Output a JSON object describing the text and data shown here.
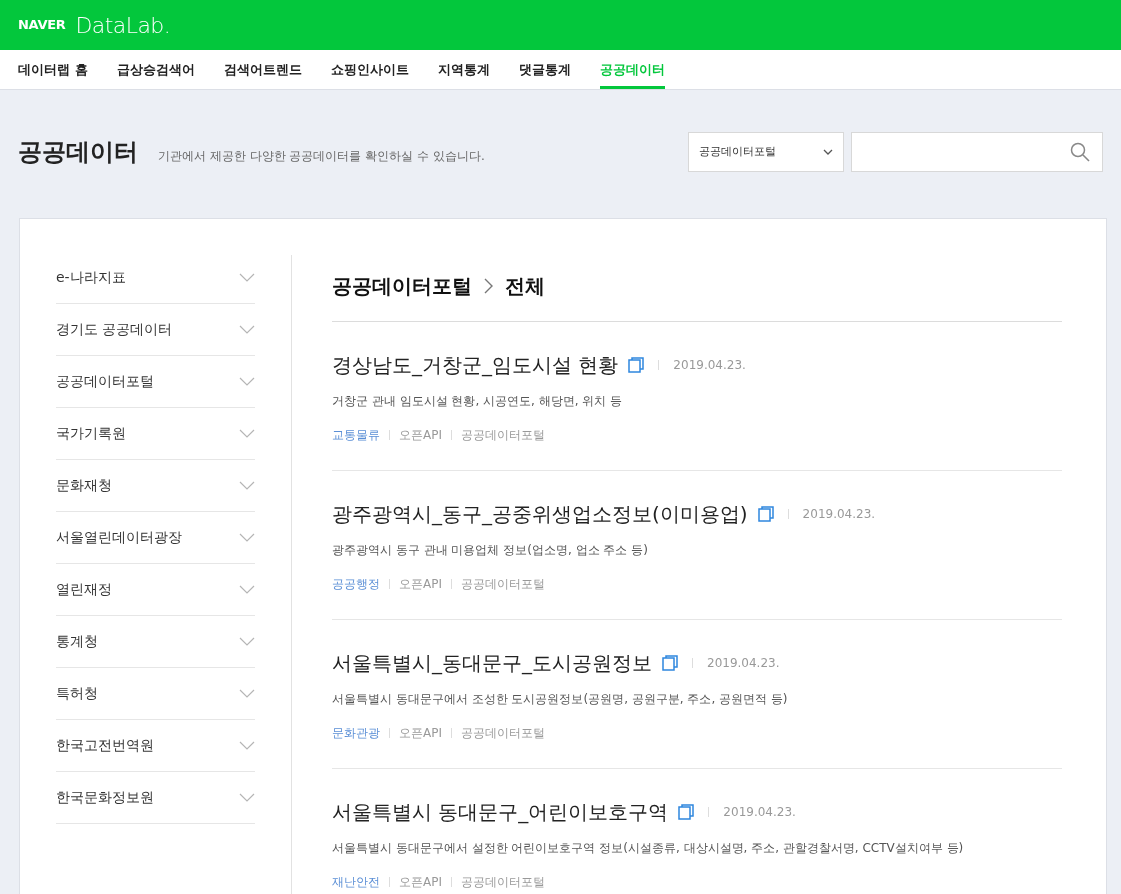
{
  "header": {
    "brand": "NAVER",
    "product": "DataLab."
  },
  "nav": [
    {
      "label": "데이터랩 홈",
      "selected": false
    },
    {
      "label": "급상승검색어",
      "selected": false
    },
    {
      "label": "검색어트렌드",
      "selected": false
    },
    {
      "label": "쇼핑인사이트",
      "selected": false
    },
    {
      "label": "지역통계",
      "selected": false
    },
    {
      "label": "댓글통계",
      "selected": false
    },
    {
      "label": "공공데이터",
      "selected": true
    }
  ],
  "page": {
    "title": "공공데이터",
    "subtitle": "기관에서 제공한 다양한 공공데이터를 확인하실 수 있습니다.",
    "source_select": "공공데이터포털"
  },
  "sidebar": {
    "items": [
      {
        "label": "e-나라지표",
        "expanded": false
      },
      {
        "label": "경기도 공공데이터",
        "expanded": false
      },
      {
        "label": "공공데이터포털",
        "expanded": false
      },
      {
        "label": "국가기록원",
        "expanded": false
      },
      {
        "label": "문화재청",
        "expanded": false
      },
      {
        "label": "서울열린데이터광장",
        "expanded": false
      },
      {
        "label": "열린재정",
        "expanded": false
      },
      {
        "label": "통계청",
        "expanded": false
      },
      {
        "label": "특허청",
        "expanded": false
      },
      {
        "label": "한국고전번역원",
        "expanded": false
      },
      {
        "label": "한국문화정보원",
        "expanded": false
      }
    ]
  },
  "breadcrumb": [
    "공공데이터포털",
    "전체"
  ],
  "datasets": [
    {
      "title": "경상남도_거창군_임도시설 현황",
      "date": "2019.04.23.",
      "description": "거창군 관내 임도시설 현황, 시공연도, 해당면, 위치 등",
      "category": "교통물류",
      "type": "오픈API",
      "provider": "공공데이터포털"
    },
    {
      "title": "광주광역시_동구_공중위생업소정보(이미용업)",
      "date": "2019.04.23.",
      "description": "광주광역시 동구 관내 미용업체 정보(업소명, 업소 주소 등)",
      "category": "공공행정",
      "type": "오픈API",
      "provider": "공공데이터포털"
    },
    {
      "title": "서울특별시_동대문구_도시공원정보",
      "date": "2019.04.23.",
      "description": "서울특별시 동대문구에서 조성한 도시공원정보(공원명, 공원구분, 주소, 공원면적 등)",
      "category": "문화관광",
      "type": "오픈API",
      "provider": "공공데이터포털"
    },
    {
      "title": "서울특별시 동대문구_어린이보호구역",
      "date": "2019.04.23.",
      "description": "서울특별시 동대문구에서 설정한 어린이보호구역 정보(시설종류, 대상시설명, 주소, 관할경찰서명, CCTV설치여부 등)",
      "category": "재난안전",
      "type": "오픈API",
      "provider": "공공데이터포털"
    }
  ]
}
